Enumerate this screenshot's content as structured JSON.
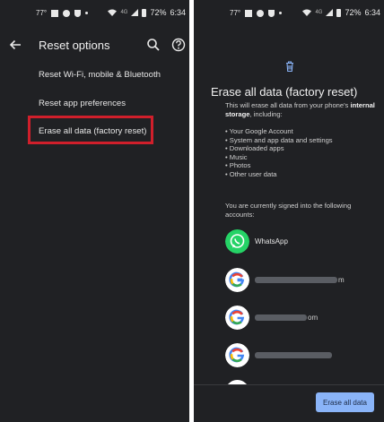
{
  "left_screen": {
    "status": {
      "temp": "77°",
      "battery": "72%",
      "time": "6:34",
      "network": "4G"
    },
    "header": {
      "title": "Reset options"
    },
    "options": [
      "Reset Wi-Fi, mobile & Bluetooth",
      "Reset app preferences",
      "Erase all data (factory reset)"
    ],
    "highlight_color": "#d01f2b"
  },
  "right_screen": {
    "status": {
      "temp": "77°",
      "battery": "72%",
      "time": "6:34",
      "network": "4G"
    },
    "title": "Erase all data (factory reset)",
    "desc_prefix": "This will erase all data from your phone's",
    "desc_bold": "internal storage",
    "desc_suffix": ", including:",
    "items": [
      "• Your Google Account",
      "• System and app data and settings",
      "• Downloaded apps",
      "• Music",
      "• Photos",
      "• Other user data"
    ],
    "signed_in_text": "You are currently signed into the following accounts:",
    "accounts": [
      {
        "name": "WhatsApp",
        "icon": "whatsapp-icon"
      },
      {
        "end": "m",
        "icon": "google-icon"
      },
      {
        "end": "om",
        "icon": "google-icon"
      },
      {
        "end": "",
        "icon": "google-icon"
      }
    ],
    "button_label": "Erase all data",
    "accent": "#8ab4f8"
  }
}
